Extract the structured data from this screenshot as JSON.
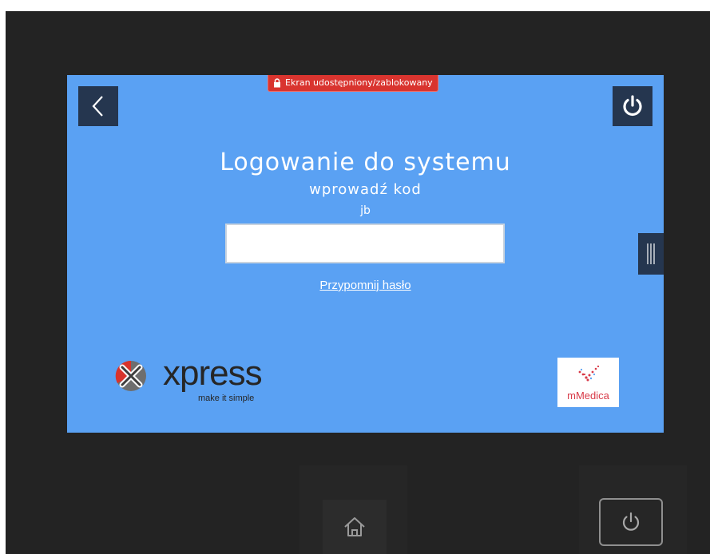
{
  "banner": {
    "text": "Ekran udostępniony/zablokowany",
    "icon": "lock-icon",
    "color": "#d9342f"
  },
  "header": {
    "back_icon": "chevron-left-icon",
    "power_icon": "power-icon"
  },
  "login": {
    "title": "Logowanie do systemu",
    "subtitle": "wprowadź kod",
    "username": "jb",
    "code_value": "",
    "remind_link": "Przypomnij hasło"
  },
  "logos": {
    "xpress": {
      "name": "xpress",
      "tagline": "make it simple"
    },
    "mmedica": {
      "name": "mMedica"
    }
  },
  "colors": {
    "screen_bg": "#5aa1f3",
    "button_bg": "#25364f",
    "device_bg": "#232323"
  },
  "device": {
    "home_icon": "home-icon",
    "power_icon": "power-icon"
  }
}
